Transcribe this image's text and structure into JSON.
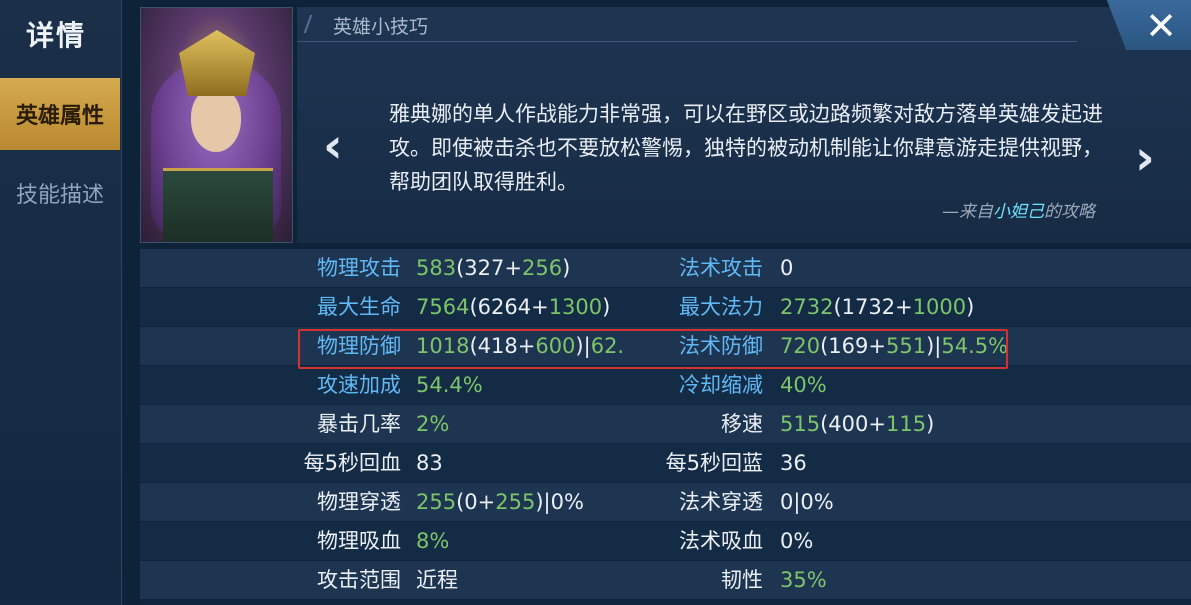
{
  "sidebar": {
    "title": "详情",
    "tabs": [
      {
        "label": "英雄属性",
        "active": true
      },
      {
        "label": "技能描述",
        "active": false
      }
    ]
  },
  "tips": {
    "header": "英雄小技巧",
    "text": "雅典娜的单人作战能力非常强，可以在野区或边路频繁对敌方落单英雄发起进攻。即使被击杀也不要放松警惕，独特的被动机制能让你肆意游走提供视野，帮助团队取得胜利。",
    "source_prefix": "—来自",
    "source_author": "小妲己",
    "source_suffix": "的攻略",
    "prev_glyph": "‹",
    "next_glyph": "›",
    "close_glyph": "✕"
  },
  "stats": {
    "rows": [
      {
        "left": {
          "label": "物理攻击",
          "label_style": "blue",
          "parts": [
            [
              "583",
              "g"
            ],
            [
              "(327+",
              "w"
            ],
            [
              "256",
              "g"
            ],
            [
              ")",
              "w"
            ]
          ]
        },
        "right": {
          "label": "法术攻击",
          "label_style": "blue",
          "parts": [
            [
              "0",
              "w"
            ]
          ]
        }
      },
      {
        "left": {
          "label": "最大生命",
          "label_style": "blue",
          "parts": [
            [
              "7564",
              "g"
            ],
            [
              "(6264+",
              "w"
            ],
            [
              "1300",
              "g"
            ],
            [
              ")",
              "w"
            ]
          ]
        },
        "right": {
          "label": "最大法力",
          "label_style": "blue",
          "parts": [
            [
              "2732",
              "g"
            ],
            [
              "(1732+",
              "w"
            ],
            [
              "1000",
              "g"
            ],
            [
              ")",
              "w"
            ]
          ]
        }
      },
      {
        "left": {
          "label": "物理防御",
          "label_style": "blue",
          "parts": [
            [
              "1018",
              "g"
            ],
            [
              "(418+",
              "w"
            ],
            [
              "600",
              "g"
            ],
            [
              ")|",
              "w"
            ],
            [
              "62.",
              "g"
            ]
          ]
        },
        "right": {
          "label": "法术防御",
          "label_style": "blue",
          "parts": [
            [
              "720",
              "g"
            ],
            [
              "(169+",
              "w"
            ],
            [
              "551",
              "g"
            ],
            [
              ")|",
              "w"
            ],
            [
              "54.5%",
              "g"
            ]
          ]
        }
      },
      {
        "left": {
          "label": "攻速加成",
          "label_style": "blue",
          "parts": [
            [
              "54.4%",
              "g"
            ]
          ]
        },
        "right": {
          "label": "冷却缩减",
          "label_style": "blue",
          "parts": [
            [
              "40%",
              "g"
            ]
          ]
        }
      },
      {
        "left": {
          "label": "暴击几率",
          "label_style": "white",
          "parts": [
            [
              "2%",
              "g"
            ]
          ]
        },
        "right": {
          "label": "移速",
          "label_style": "white",
          "parts": [
            [
              "515",
              "g"
            ],
            [
              "(400+",
              "w"
            ],
            [
              "115",
              "g"
            ],
            [
              ")",
              "w"
            ]
          ]
        }
      },
      {
        "left": {
          "label": "每5秒回血",
          "label_style": "white",
          "parts": [
            [
              "83",
              "w"
            ]
          ]
        },
        "right": {
          "label": "每5秒回蓝",
          "label_style": "white",
          "parts": [
            [
              "36",
              "w"
            ]
          ]
        }
      },
      {
        "left": {
          "label": "物理穿透",
          "label_style": "white",
          "parts": [
            [
              "255",
              "g"
            ],
            [
              "(0+",
              "w"
            ],
            [
              "255",
              "g"
            ],
            [
              ")|0%",
              "w"
            ]
          ]
        },
        "right": {
          "label": "法术穿透",
          "label_style": "white",
          "parts": [
            [
              "0|0%",
              "w"
            ]
          ]
        }
      },
      {
        "left": {
          "label": "物理吸血",
          "label_style": "white",
          "parts": [
            [
              "8%",
              "g"
            ]
          ]
        },
        "right": {
          "label": "法术吸血",
          "label_style": "white",
          "parts": [
            [
              "0%",
              "w"
            ]
          ]
        }
      },
      {
        "left": {
          "label": "攻击范围",
          "label_style": "white",
          "parts": [
            [
              "近程",
              "w"
            ]
          ]
        },
        "right": {
          "label": "韧性",
          "label_style": "white",
          "parts": [
            [
              "35%",
              "g"
            ]
          ]
        }
      }
    ]
  },
  "colors": {
    "accent_gold": "#c99b3e",
    "label_blue": "#60b8f4",
    "value_green": "#7dc46a",
    "highlight_red": "#d3322f"
  }
}
